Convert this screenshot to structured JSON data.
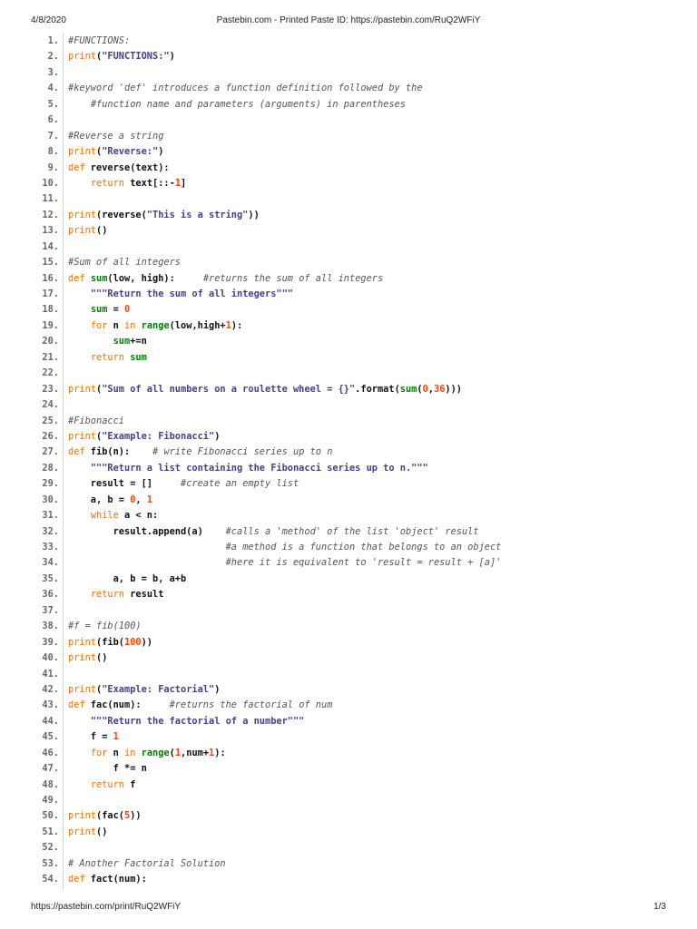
{
  "header": {
    "date": "4/8/2020",
    "title": "Pastebin.com - Printed Paste ID: https://pastebin.com/RuQ2WFiY"
  },
  "footer": {
    "url": "https://pastebin.com/print/RuQ2WFiY",
    "page": "1/3"
  },
  "colors": {
    "keyword": "#f07500",
    "string": "#483d8b",
    "number": "#ff4500",
    "builtin": "#008000",
    "comment": "#555555"
  },
  "lines": [
    {
      "n": "1.",
      "t": [
        [
          "c",
          "#FUNCTIONS:"
        ]
      ]
    },
    {
      "n": "2.",
      "t": [
        [
          "k",
          "print"
        ],
        [
          "p",
          "("
        ],
        [
          "s",
          "\"FUNCTIONS:\""
        ],
        [
          "p",
          ")"
        ]
      ]
    },
    {
      "n": "3.",
      "t": []
    },
    {
      "n": "4.",
      "t": [
        [
          "c",
          "#keyword 'def' introduces a function definition followed by the"
        ]
      ]
    },
    {
      "n": "5.",
      "t": [
        [
          "p",
          "    "
        ],
        [
          "c",
          "#function name and parameters (arguments) in parentheses"
        ]
      ]
    },
    {
      "n": "6.",
      "t": []
    },
    {
      "n": "7.",
      "t": [
        [
          "c",
          "#Reverse a string"
        ]
      ]
    },
    {
      "n": "8.",
      "t": [
        [
          "k",
          "print"
        ],
        [
          "p",
          "("
        ],
        [
          "s",
          "\"Reverse:\""
        ],
        [
          "p",
          ")"
        ]
      ]
    },
    {
      "n": "9.",
      "t": [
        [
          "k",
          "def"
        ],
        [
          "p",
          " reverse(text):"
        ]
      ]
    },
    {
      "n": "10.",
      "t": [
        [
          "p",
          "    "
        ],
        [
          "k",
          "return"
        ],
        [
          "p",
          " text[::-"
        ],
        [
          "n",
          "1"
        ],
        [
          "p",
          "]"
        ]
      ]
    },
    {
      "n": "11.",
      "t": []
    },
    {
      "n": "12.",
      "t": [
        [
          "k",
          "print"
        ],
        [
          "p",
          "(reverse("
        ],
        [
          "s",
          "\"This is a string\""
        ],
        [
          "p",
          "))"
        ]
      ]
    },
    {
      "n": "13.",
      "t": [
        [
          "k",
          "print"
        ],
        [
          "p",
          "()"
        ]
      ]
    },
    {
      "n": "14.",
      "t": []
    },
    {
      "n": "15.",
      "t": [
        [
          "c",
          "#Sum of all integers"
        ]
      ]
    },
    {
      "n": "16.",
      "t": [
        [
          "k",
          "def"
        ],
        [
          "p",
          " "
        ],
        [
          "b",
          "sum"
        ],
        [
          "p",
          "(low, high):     "
        ],
        [
          "c",
          "#returns the sum of all integers"
        ]
      ]
    },
    {
      "n": "17.",
      "t": [
        [
          "p",
          "    "
        ],
        [
          "s",
          "\"\"\"Return the sum of all integers\"\"\""
        ]
      ]
    },
    {
      "n": "18.",
      "t": [
        [
          "p",
          "    "
        ],
        [
          "b",
          "sum"
        ],
        [
          "p",
          " = "
        ],
        [
          "n",
          "0"
        ]
      ]
    },
    {
      "n": "19.",
      "t": [
        [
          "p",
          "    "
        ],
        [
          "k",
          "for"
        ],
        [
          "p",
          " n "
        ],
        [
          "k",
          "in"
        ],
        [
          "p",
          " "
        ],
        [
          "b",
          "range"
        ],
        [
          "p",
          "(low,high+"
        ],
        [
          "n",
          "1"
        ],
        [
          "p",
          "):"
        ]
      ]
    },
    {
      "n": "20.",
      "t": [
        [
          "p",
          "        "
        ],
        [
          "b",
          "sum"
        ],
        [
          "p",
          "+=n"
        ]
      ]
    },
    {
      "n": "21.",
      "t": [
        [
          "p",
          "    "
        ],
        [
          "k",
          "return"
        ],
        [
          "p",
          " "
        ],
        [
          "b",
          "sum"
        ]
      ]
    },
    {
      "n": "22.",
      "t": []
    },
    {
      "n": "23.",
      "t": [
        [
          "k",
          "print"
        ],
        [
          "p",
          "("
        ],
        [
          "s",
          "\"Sum of all numbers on a roulette wheel = {}\""
        ],
        [
          "p",
          ".format("
        ],
        [
          "b",
          "sum"
        ],
        [
          "p",
          "("
        ],
        [
          "n",
          "0"
        ],
        [
          "p",
          ","
        ],
        [
          "n",
          "36"
        ],
        [
          "p",
          ")))"
        ]
      ]
    },
    {
      "n": "24.",
      "t": []
    },
    {
      "n": "25.",
      "t": [
        [
          "c",
          "#Fibonacci"
        ]
      ]
    },
    {
      "n": "26.",
      "t": [
        [
          "k",
          "print"
        ],
        [
          "p",
          "("
        ],
        [
          "s",
          "\"Example: Fibonacci\""
        ],
        [
          "p",
          ")"
        ]
      ]
    },
    {
      "n": "27.",
      "t": [
        [
          "k",
          "def"
        ],
        [
          "p",
          " fib(n):    "
        ],
        [
          "c",
          "# write Fibonacci series up to n"
        ]
      ]
    },
    {
      "n": "28.",
      "t": [
        [
          "p",
          "    "
        ],
        [
          "s",
          "\"\"\"Return a list containing the Fibonacci series up to n.\"\"\""
        ]
      ]
    },
    {
      "n": "29.",
      "t": [
        [
          "p",
          "    result = []     "
        ],
        [
          "c",
          "#create an empty list"
        ]
      ]
    },
    {
      "n": "30.",
      "t": [
        [
          "p",
          "    a, b = "
        ],
        [
          "n",
          "0"
        ],
        [
          "p",
          ", "
        ],
        [
          "n",
          "1"
        ]
      ]
    },
    {
      "n": "31.",
      "t": [
        [
          "p",
          "    "
        ],
        [
          "k",
          "while"
        ],
        [
          "p",
          " a < n:"
        ]
      ]
    },
    {
      "n": "32.",
      "t": [
        [
          "p",
          "        result.append(a)    "
        ],
        [
          "c",
          "#calls a 'method' of the list 'object' result"
        ]
      ]
    },
    {
      "n": "33.",
      "t": [
        [
          "p",
          "                            "
        ],
        [
          "c",
          "#a method is a function that belongs to an object"
        ]
      ]
    },
    {
      "n": "34.",
      "t": [
        [
          "p",
          "                            "
        ],
        [
          "c",
          "#here it is equivalent to 'result = result + [a]'"
        ]
      ]
    },
    {
      "n": "35.",
      "t": [
        [
          "p",
          "        a, b = b, a+b"
        ]
      ]
    },
    {
      "n": "36.",
      "t": [
        [
          "p",
          "    "
        ],
        [
          "k",
          "return"
        ],
        [
          "p",
          " result"
        ]
      ]
    },
    {
      "n": "37.",
      "t": []
    },
    {
      "n": "38.",
      "t": [
        [
          "c",
          "#f = fib(100)"
        ]
      ]
    },
    {
      "n": "39.",
      "t": [
        [
          "k",
          "print"
        ],
        [
          "p",
          "(fib("
        ],
        [
          "n",
          "100"
        ],
        [
          "p",
          "))"
        ]
      ]
    },
    {
      "n": "40.",
      "t": [
        [
          "k",
          "print"
        ],
        [
          "p",
          "()"
        ]
      ]
    },
    {
      "n": "41.",
      "t": []
    },
    {
      "n": "42.",
      "t": [
        [
          "k",
          "print"
        ],
        [
          "p",
          "("
        ],
        [
          "s",
          "\"Example: Factorial\""
        ],
        [
          "p",
          ")"
        ]
      ]
    },
    {
      "n": "43.",
      "t": [
        [
          "k",
          "def"
        ],
        [
          "p",
          " fac(num):     "
        ],
        [
          "c",
          "#returns the factorial of num"
        ]
      ]
    },
    {
      "n": "44.",
      "t": [
        [
          "p",
          "    "
        ],
        [
          "s",
          "\"\"\"Return the factorial of a number\"\"\""
        ]
      ]
    },
    {
      "n": "45.",
      "t": [
        [
          "p",
          "    f = "
        ],
        [
          "n",
          "1"
        ]
      ]
    },
    {
      "n": "46.",
      "t": [
        [
          "p",
          "    "
        ],
        [
          "k",
          "for"
        ],
        [
          "p",
          " n "
        ],
        [
          "k",
          "in"
        ],
        [
          "p",
          " "
        ],
        [
          "b",
          "range"
        ],
        [
          "p",
          "("
        ],
        [
          "n",
          "1"
        ],
        [
          "p",
          ",num+"
        ],
        [
          "n",
          "1"
        ],
        [
          "p",
          "):"
        ]
      ]
    },
    {
      "n": "47.",
      "t": [
        [
          "p",
          "        f *= n"
        ]
      ]
    },
    {
      "n": "48.",
      "t": [
        [
          "p",
          "    "
        ],
        [
          "k",
          "return"
        ],
        [
          "p",
          " f"
        ]
      ]
    },
    {
      "n": "49.",
      "t": []
    },
    {
      "n": "50.",
      "t": [
        [
          "k",
          "print"
        ],
        [
          "p",
          "(fac("
        ],
        [
          "n",
          "5"
        ],
        [
          "p",
          "))"
        ]
      ]
    },
    {
      "n": "51.",
      "t": [
        [
          "k",
          "print"
        ],
        [
          "p",
          "()"
        ]
      ]
    },
    {
      "n": "52.",
      "t": []
    },
    {
      "n": "53.",
      "t": [
        [
          "c",
          "# Another Factorial Solution"
        ]
      ]
    },
    {
      "n": "54.",
      "t": [
        [
          "k",
          "def"
        ],
        [
          "p",
          " fact(num):"
        ]
      ]
    }
  ]
}
